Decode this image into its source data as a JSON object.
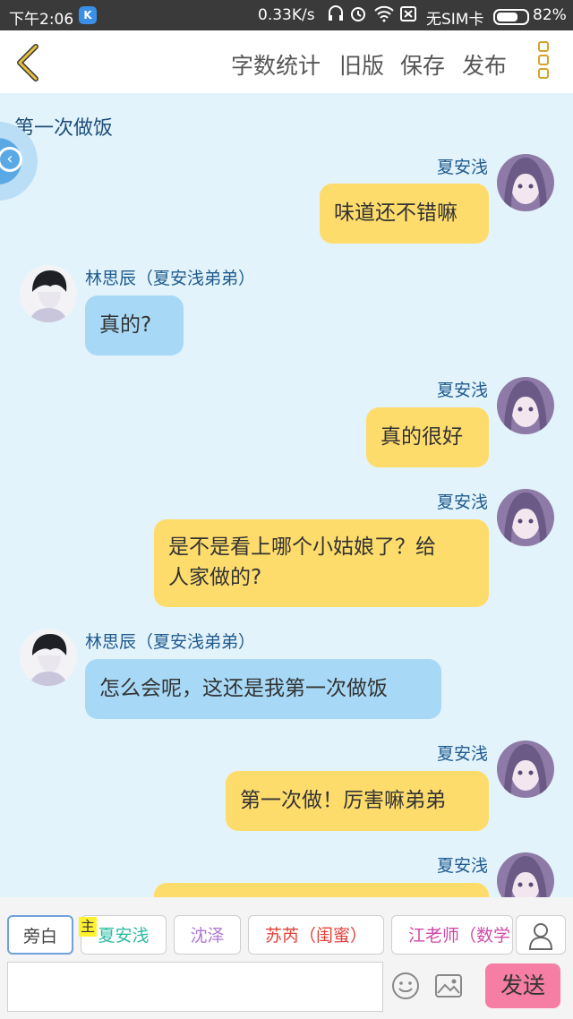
{
  "status_bar": {
    "time": "下午2:06",
    "k_badge": "K",
    "speed": "0.33K/s",
    "sim": "无SIM卡",
    "battery_level": 0.82,
    "battery_pct": "82%"
  },
  "top_bar": {
    "word_count": "字数统计",
    "old_version": "旧版",
    "save": "保存",
    "publish": "发布"
  },
  "chat": {
    "title": "第一次做饭",
    "messages": [
      {
        "side": "right",
        "name": "夏安浅",
        "text": "味道还不错嘛"
      },
      {
        "side": "left",
        "name": "林思辰（夏安浅弟弟）",
        "text": "真的?"
      },
      {
        "side": "right",
        "name": "夏安浅",
        "text": "真的很好"
      },
      {
        "side": "right",
        "name": "夏安浅",
        "text_line1": "是不是看上哪个小姑娘了？给",
        "text_line2": "人家做的?"
      },
      {
        "side": "left",
        "name": "林思辰（夏安浅弟弟）",
        "text": "怎么会呢，这还是我第一次做饭"
      },
      {
        "side": "right",
        "name": "夏安浅",
        "text": "第一次做！厉害嘛弟弟"
      },
      {
        "side": "right",
        "name": "夏安浅",
        "text": ""
      }
    ]
  },
  "roles": [
    {
      "label": "旁白",
      "color": "#444444"
    },
    {
      "label": "夏安浅",
      "color": "#2bbca0",
      "badge": "主"
    },
    {
      "label": "沈泽",
      "color": "#b07ad6"
    },
    {
      "label": "苏芮（闺蜜）",
      "color": "#e0413a"
    },
    {
      "label": "江老师（数学",
      "color": "#d04aa8"
    }
  ],
  "composer": {
    "input_value": "",
    "send_label": "发送"
  },
  "colors": {
    "background": "#e3f3fb",
    "right_bubble": "#fedc6c",
    "left_bubble": "#a7d9f6",
    "send_button": "#f67ea4"
  }
}
